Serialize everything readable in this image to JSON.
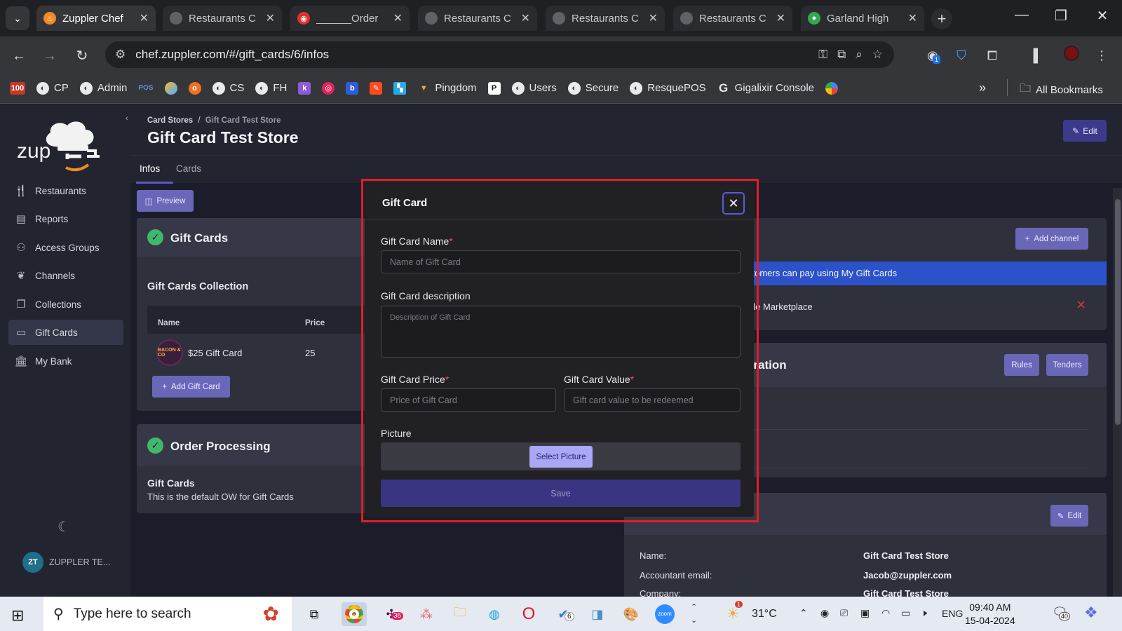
{
  "browser": {
    "tabs": [
      {
        "title": "Zuppler Chef",
        "active": true
      },
      {
        "title": "Restaurants C",
        "active": false
      },
      {
        "title": "______Order",
        "active": false
      },
      {
        "title": "Restaurants C",
        "active": false
      },
      {
        "title": "Restaurants C",
        "active": false
      },
      {
        "title": "Restaurants C",
        "active": false
      },
      {
        "title": "Garland High",
        "active": false
      }
    ],
    "url": "chef.zuppler.com/#/gift_cards/6/infos",
    "extension_badge": "1",
    "bookmarks": [
      {
        "label": "CP"
      },
      {
        "label": "Admin"
      },
      {
        "label": "CS"
      },
      {
        "label": "FH"
      },
      {
        "label": "Pingdom"
      },
      {
        "label": "Users"
      },
      {
        "label": "Secure"
      },
      {
        "label": "ResquePOS"
      },
      {
        "label": "Gigalixir Console"
      }
    ],
    "bookmarks_extra": {
      "more": "»",
      "all_bookmarks": "All Bookmarks",
      "pos_badge": "POS",
      "hundred_badge": "100"
    }
  },
  "sidebar": {
    "logo_text": "zup",
    "items": [
      {
        "label": "Restaurants",
        "icon": "fork-knife-icon"
      },
      {
        "label": "Reports",
        "icon": "report-icon"
      },
      {
        "label": "Access Groups",
        "icon": "users-icon"
      },
      {
        "label": "Channels",
        "icon": "leaf-icon"
      },
      {
        "label": "Collections",
        "icon": "collection-icon"
      },
      {
        "label": "Gift Cards",
        "icon": "card-icon",
        "selected": true
      },
      {
        "label": "My Bank",
        "icon": "bank-icon"
      }
    ],
    "user": {
      "initials": "ZT",
      "name": "ZUPPLER TE..."
    }
  },
  "page": {
    "breadcrumb": {
      "parent": "Card Stores",
      "sep": "/",
      "current": "Gift Card Test Store"
    },
    "title": "Gift Card Test Store",
    "edit_label": "Edit",
    "tabs": [
      {
        "label": "Infos",
        "active": true
      },
      {
        "label": "Cards",
        "active": false
      }
    ],
    "preview_label": "Preview",
    "gift_cards_section": {
      "title": "Gift Cards",
      "collection_title": "Gift Cards Collection",
      "columns": [
        "Name",
        "Price"
      ],
      "rows": [
        {
          "image_text": "BACON & CO",
          "name": "$25 Gift Card",
          "price": "25"
        }
      ],
      "add_label": "Add Gift Card"
    },
    "order_processing": {
      "title": "Order Processing",
      "subtitle": "Gift Cards",
      "description": "This is the default OW for Gift Cards"
    },
    "right_panel": {
      "add_channel_label": "Add channel",
      "channel_banner": "stomers can pay using My Gift Cards",
      "channel_item": "ple Marketplace",
      "config_title": "uration",
      "rules_label": "Rules",
      "tenders_label": "Tenders",
      "edit_label": "Edit",
      "info_rows": [
        {
          "label": "Name:",
          "value": "Gift Card Test Store"
        },
        {
          "label": "Accountant email:",
          "value": "Jacob@zuppler.com"
        },
        {
          "label": "Company:",
          "value": "Gift Card Test Store"
        }
      ]
    }
  },
  "modal": {
    "title": "Gift Card",
    "fields": {
      "name": {
        "label": "Gift Card Name",
        "required": "*",
        "placeholder": "Name of Gift Card",
        "value": ""
      },
      "description": {
        "label": "Gift Card description",
        "placeholder": "Description of Gift Card",
        "value": ""
      },
      "price": {
        "label": "Gift Card Price",
        "required": "*",
        "placeholder": "Price of Gift Card",
        "value": ""
      },
      "value": {
        "label": "Gift Card Value",
        "required": "*",
        "placeholder": "Gift card value to be redeemed",
        "value": ""
      },
      "picture": {
        "label": "Picture",
        "button": "Select Picture"
      }
    },
    "save_label": "Save"
  },
  "taskbar": {
    "search_placeholder": "Type here to search",
    "badges": {
      "slack": "36",
      "todo": "6",
      "weather_alert": "1",
      "notifications": "40"
    },
    "weather": "31°C",
    "language": "ENG",
    "time": "09:40 AM",
    "date": "15-04-2024"
  },
  "colors": {
    "accent": "#5c58c7",
    "annotation_frame": "#e51c23",
    "success": "#3fb86c",
    "banner": "#2c52c9"
  }
}
